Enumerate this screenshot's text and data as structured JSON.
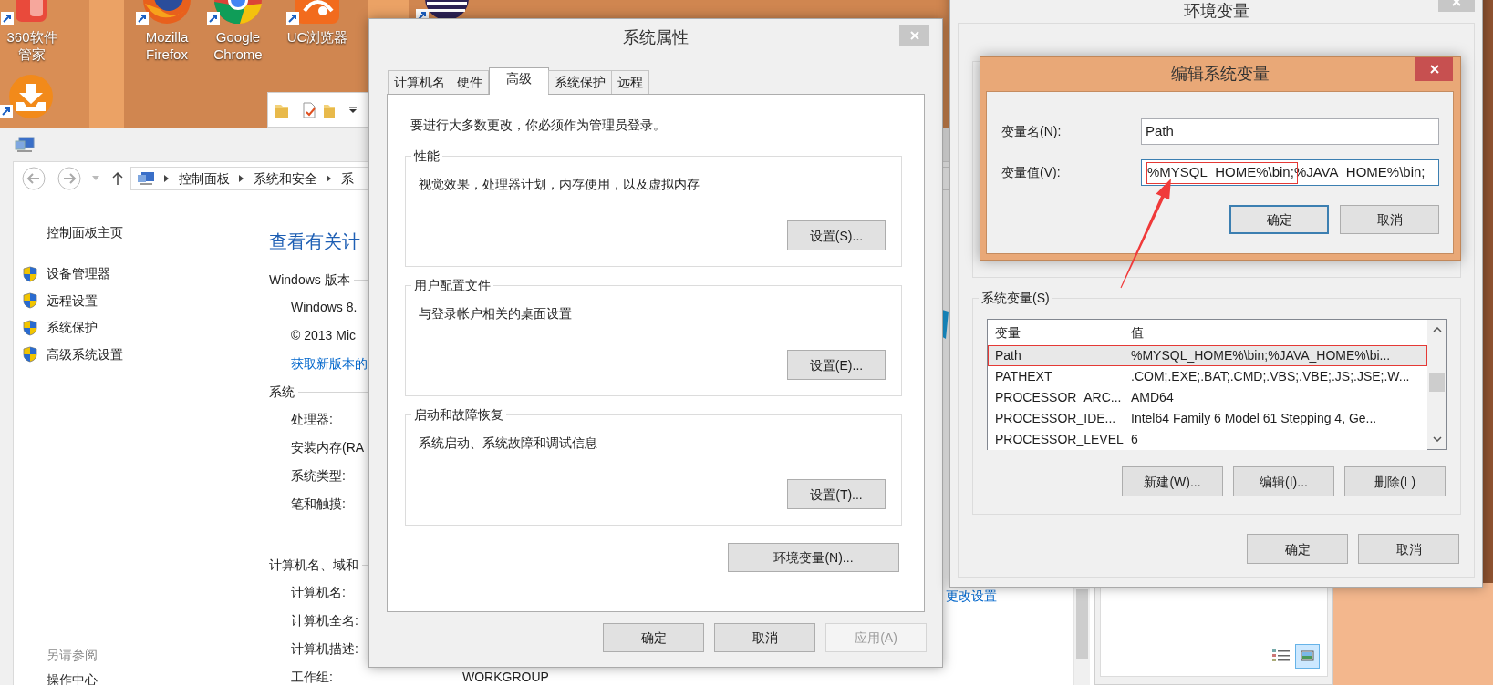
{
  "desktop": {
    "icons": [
      {
        "kind": "app360",
        "label": "360软件管家"
      },
      {
        "kind": "firefox",
        "label": "Mozilla Firefox"
      },
      {
        "kind": "chrome",
        "label": "Google Chrome"
      },
      {
        "kind": "uc",
        "label": "UC浏览器"
      },
      {
        "kind": "eclipse"
      },
      {
        "kind": "download"
      }
    ]
  },
  "control_panel": {
    "breadcrumbs": [
      "控制面板",
      "系统和安全",
      "系"
    ],
    "sidebar": {
      "home": "控制面板主页",
      "items": [
        "设备管理器",
        "远程设置",
        "系统保护",
        "高级系统设置"
      ],
      "see_also": "另请参阅",
      "see_also_items": [
        "操作中心"
      ]
    },
    "title": "查看有关计",
    "sections": [
      {
        "heading": "Windows 版本",
        "lines": [
          {
            "kind": "text",
            "label": "Windows 8."
          },
          {
            "kind": "text",
            "label": "© 2013 Mic"
          },
          {
            "kind": "link",
            "label": "获取新版本的"
          }
        ]
      },
      {
        "heading": "系统",
        "lines": [
          {
            "kind": "text",
            "label": "处理器:"
          },
          {
            "kind": "text",
            "label": "安装内存(RA"
          },
          {
            "kind": "text",
            "label": "系统类型:"
          },
          {
            "kind": "text",
            "label": "笔和触摸:"
          }
        ]
      },
      {
        "heading": "计算机名、域和",
        "lines": [
          {
            "kind": "text",
            "label": "计算机名:"
          },
          {
            "kind": "text",
            "label": "计算机全名:"
          },
          {
            "kind": "text",
            "label": "计算机描述:"
          },
          {
            "kind": "text",
            "label": "工作组:",
            "value": "WORKGROUP"
          }
        ]
      }
    ],
    "change_settings_link": "更改设置"
  },
  "system_properties": {
    "title": "系统属性",
    "tabs": [
      {
        "label": "计算机名",
        "selected": false
      },
      {
        "label": "硬件",
        "selected": false
      },
      {
        "label": "高级",
        "selected": true
      },
      {
        "label": "系统保护",
        "selected": false
      },
      {
        "label": "远程",
        "selected": false
      }
    ],
    "notice": "要进行大多数更改，你必须作为管理员登录。",
    "groups": [
      {
        "legend": "性能",
        "description": "视觉效果，处理器计划，内存使用，以及虚拟内存",
        "button": "设置(S)..."
      },
      {
        "legend": "用户配置文件",
        "description": "与登录帐户相关的桌面设置",
        "button": "设置(E)..."
      },
      {
        "legend": "启动和故障恢复",
        "description": "系统启动、系统故障和调试信息",
        "button": "设置(T)..."
      }
    ],
    "env_button": "环境变量(N)...",
    "buttons": [
      {
        "label": "确定",
        "disabled": false
      },
      {
        "label": "取消",
        "disabled": false
      },
      {
        "label": "应用(A)",
        "disabled": true
      }
    ]
  },
  "environment_variables": {
    "title": "环境变量",
    "system_group": {
      "label": "系统变量(S)",
      "columns": [
        "变量",
        "值"
      ],
      "rows": [
        {
          "name": "Path",
          "value": "%MYSQL_HOME%\\bin;%JAVA_HOME%\\bi...",
          "selected": true,
          "marked": true
        },
        {
          "name": "PATHEXT",
          "value": ".COM;.EXE;.BAT;.CMD;.VBS;.VBE;.JS;.JSE;.W...",
          "selected": false,
          "marked": false
        },
        {
          "name": "PROCESSOR_ARC...",
          "value": "AMD64",
          "selected": false,
          "marked": false
        },
        {
          "name": "PROCESSOR_IDE...",
          "value": "Intel64 Family 6 Model 61 Stepping 4, Ge...",
          "selected": false,
          "marked": false
        },
        {
          "name": "PROCESSOR_LEVEL",
          "value": "6",
          "selected": false,
          "marked": false
        }
      ],
      "buttons": [
        "新建(W)...",
        "编辑(I)...",
        "删除(L)"
      ]
    },
    "buttons": [
      "确定",
      "取消"
    ]
  },
  "edit_dialog": {
    "title": "编辑系统变量",
    "fields": [
      {
        "label": "变量名(N):",
        "value": "Path",
        "focused": false,
        "marked": false
      },
      {
        "label": "变量值(V):",
        "value": "%MYSQL_HOME%\\bin;%JAVA_HOME%\\bin;",
        "focused": true,
        "marked": true
      }
    ],
    "buttons": [
      {
        "label": "确定",
        "default": true
      },
      {
        "label": "取消",
        "default": false
      }
    ]
  }
}
